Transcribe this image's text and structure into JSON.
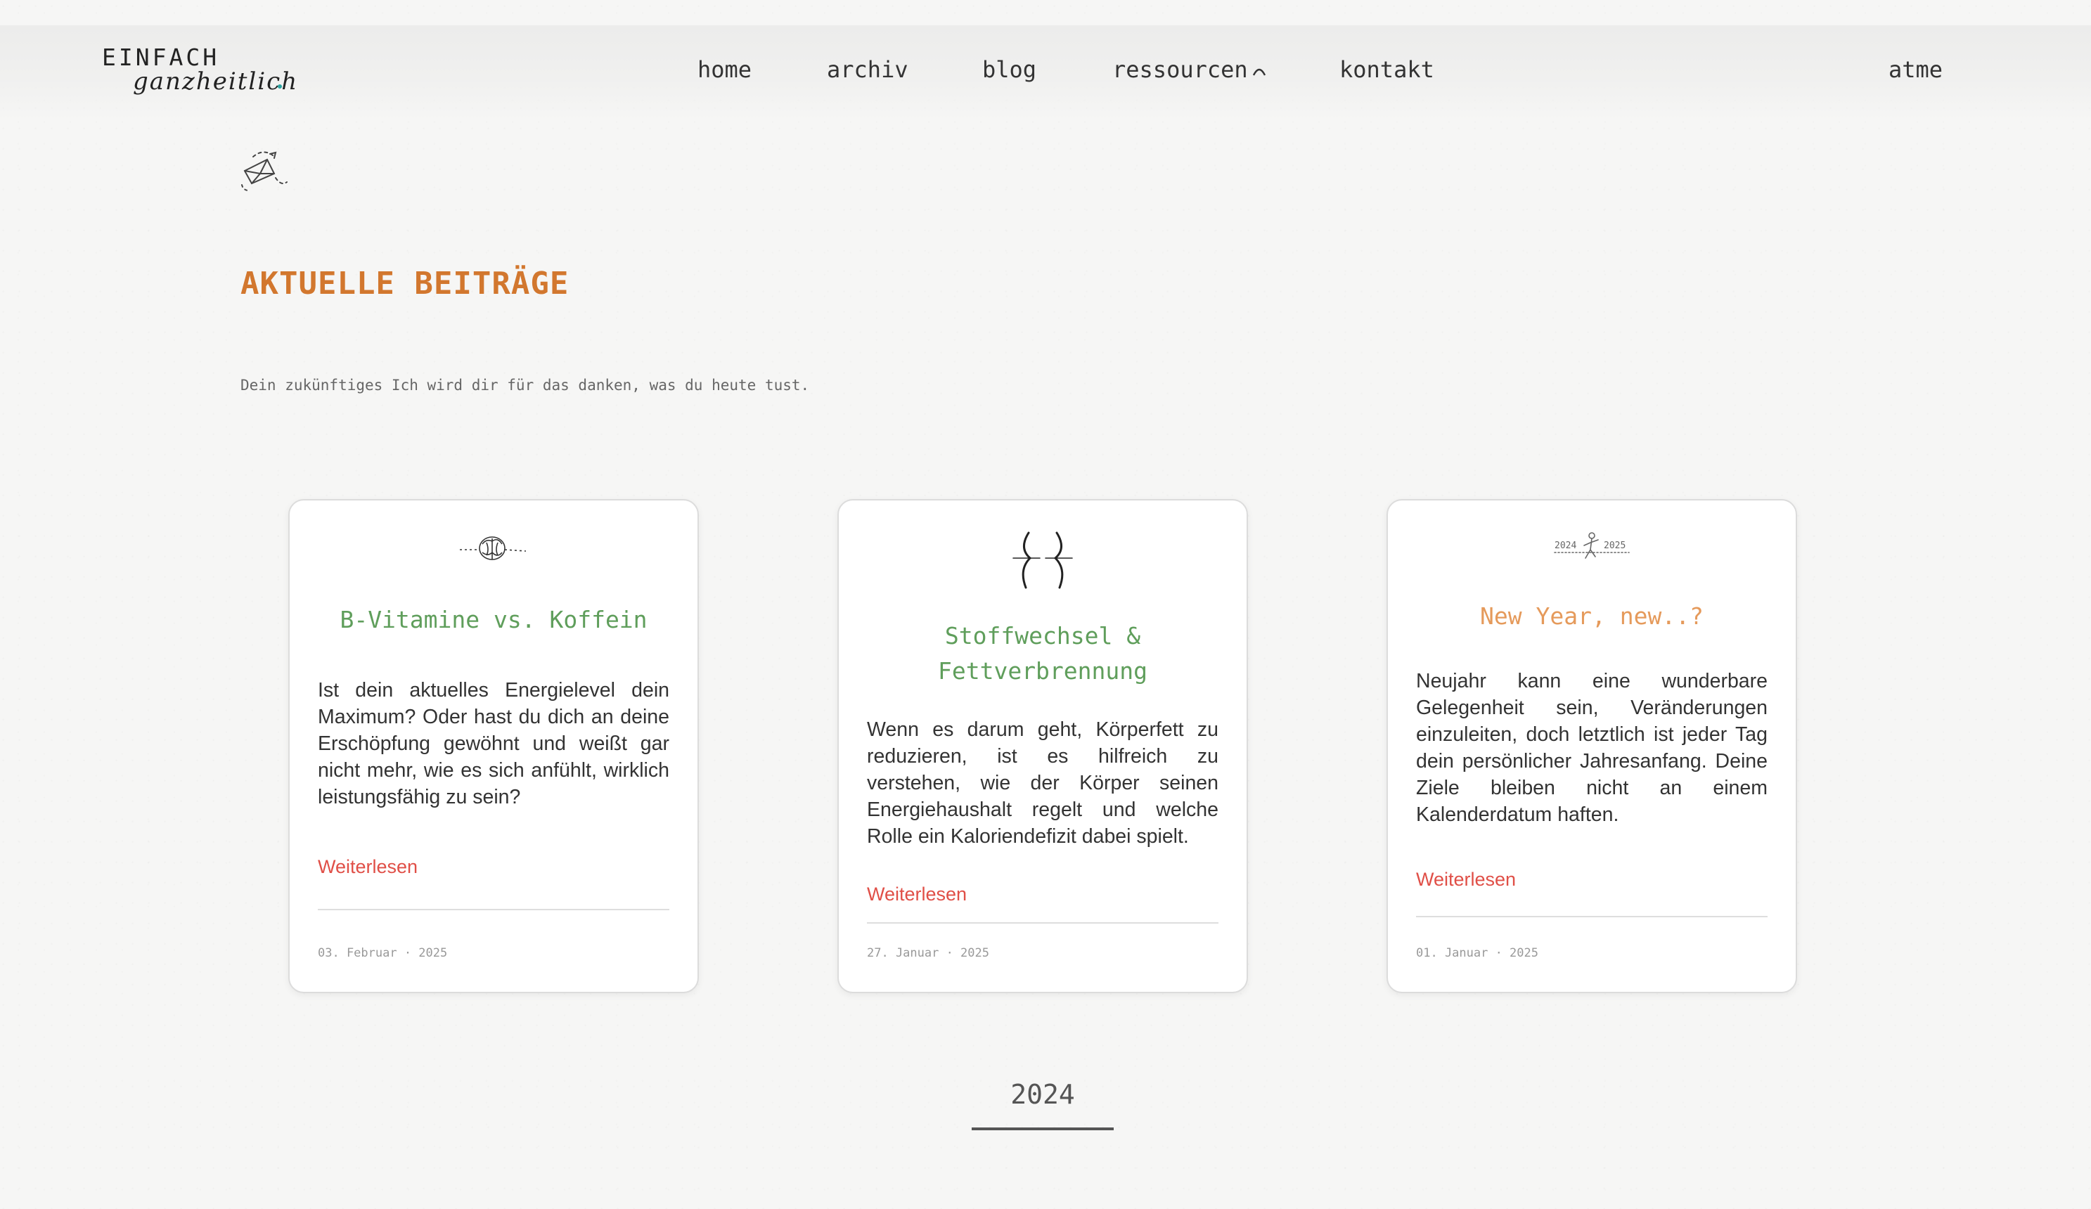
{
  "header": {
    "logo_line1": "EINFACH",
    "logo_line2": "ganzheitlich",
    "nav": {
      "home": "home",
      "archiv": "archiv",
      "blog": "blog",
      "ressourcen": "ressourcen",
      "kontakt": "kontakt",
      "atme": "atme"
    }
  },
  "main": {
    "title": "AKTUELLE BEITRÄGE",
    "subtitle": "Dein zukünftiges Ich wird dir für das danken, was du heute tust.",
    "posts": [
      {
        "title": "B-Vitamine vs. Koffein",
        "excerpt": "Ist dein aktuelles Energielevel dein Maximum? Oder hast du dich an deine Erschöpfung gewöhnt und weißt gar nicht mehr, wie es sich anfühlt, wirklich leistungsfähig zu sein?",
        "link": "Weiterlesen",
        "date": "03. Februar · 2025",
        "illustration": "brain-icon"
      },
      {
        "title": "Stoffwechsel & Fettverbrennung",
        "excerpt": "Wenn es darum geht, Körperfett zu reduzieren, ist es hilfreich zu verstehen, wie der Körper seinen Energiehaushalt regelt und welche Rolle ein Kaloriendefizit dabei spielt.",
        "link": "Weiterlesen",
        "date": "27. Januar · 2025",
        "illustration": "waist-curves-icon"
      },
      {
        "title": "New Year, new..?",
        "excerpt": "Neujahr kann eine wunderbare Gelegenheit sein, Veränderungen einzuleiten, doch letztlich ist jeder Tag dein persönlicher Jahresanfang. Deine Ziele bleiben nicht an einem Kalenderdatum haften.",
        "link": "Weiterlesen",
        "date": "01. Januar · 2025",
        "illustration": "year-transition-icon",
        "illustration_labels": [
          "2024",
          "2025"
        ]
      }
    ],
    "year_tab": "2024"
  },
  "colors": {
    "accent_orange": "#d2772e",
    "title_green": "#5f9e5b",
    "title_orange": "#e59a5b",
    "link_red": "#e04f47"
  }
}
